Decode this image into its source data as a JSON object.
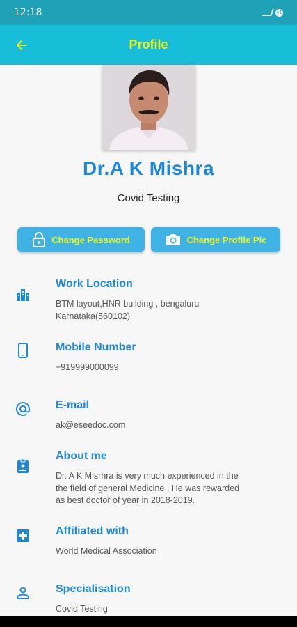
{
  "status_bar": {
    "time": "12:18",
    "battery": "41"
  },
  "app_bar": {
    "title": "Profile"
  },
  "profile": {
    "name": "Dr.A K Mishra",
    "specialty": "Covid Testing"
  },
  "actions": {
    "change_password": "Change Password",
    "change_pic": "Change Profile Pic"
  },
  "info": [
    {
      "icon": "building-icon",
      "title": "Work Location",
      "value_line1": "BTM layout,HNR building , bengaluru",
      "value_line2": "Karnataka(560102)"
    },
    {
      "icon": "phone-icon",
      "title": "Mobile Number",
      "value": "+919999000099"
    },
    {
      "icon": "at-icon",
      "title": "E-mail",
      "value": "ak@eseedoc.com"
    },
    {
      "icon": "badge-icon",
      "title": "About me",
      "value_line1": "Dr. A K  Misrhra is very much experienced in the",
      "value_line2": "the field of general Medicine , He was rewarded",
      "value_line3": "as best doctor of year in 2018-2019."
    },
    {
      "icon": "medical-plus-icon",
      "title": "Affiliated with",
      "value": "World Medical Association"
    },
    {
      "icon": "person-icon",
      "title": "Specialisation",
      "value": "Covid Testing"
    }
  ],
  "colors": {
    "status_bar": "#1fa2b7",
    "app_bar": "#18bdd8",
    "accent_yellow": "#f1f519",
    "blue": "#1e88d8",
    "button": "#3fb3e6"
  }
}
